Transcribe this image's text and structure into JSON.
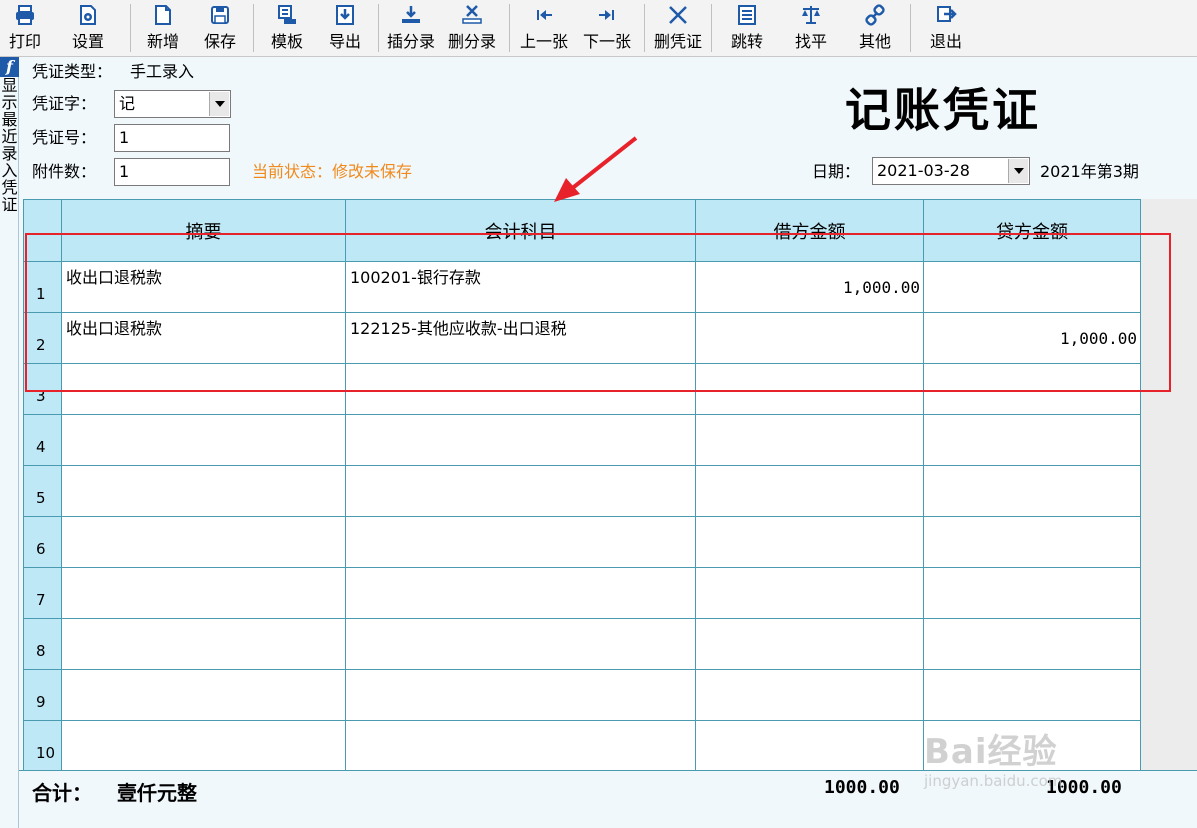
{
  "toolbar": {
    "items": [
      {
        "label": "打印",
        "icon": "printer-icon"
      },
      {
        "label": "设置",
        "icon": "settings-icon"
      },
      {
        "label": "新增",
        "icon": "new-document-icon"
      },
      {
        "label": "保存",
        "icon": "save-icon"
      },
      {
        "label": "模板",
        "icon": "template-icon"
      },
      {
        "label": "导出",
        "icon": "export-icon"
      },
      {
        "label": "插分录",
        "icon": "insert-entry-icon"
      },
      {
        "label": "删分录",
        "icon": "delete-entry-icon"
      },
      {
        "label": "上一张",
        "icon": "previous-icon"
      },
      {
        "label": "下一张",
        "icon": "next-icon"
      },
      {
        "label": "删凭证",
        "icon": "delete-voucher-icon"
      },
      {
        "label": "跳转",
        "icon": "jump-icon"
      },
      {
        "label": "找平",
        "icon": "balance-icon"
      },
      {
        "label": "其他",
        "icon": "link-icon"
      },
      {
        "label": "退出",
        "icon": "exit-icon"
      }
    ]
  },
  "sidebar": {
    "logo": "f",
    "vertical_label": "显示最近录入凭证"
  },
  "header": {
    "voucher_type_label": "凭证类型：",
    "voucher_type_value": "手工录入",
    "word_label": "凭证字：",
    "word_value": "记",
    "number_label": "凭证号：",
    "number_value": "1",
    "attachments_label": "附件数：",
    "attachments_value": "1",
    "status_text": "当前状态：修改未保存",
    "title": "记账凭证",
    "date_label": "日期：",
    "date_value": "2021-03-28",
    "period": "2021年第3期"
  },
  "grid": {
    "columns": [
      "摘要",
      "会计科目",
      "借方金额",
      "贷方金额"
    ],
    "rows": [
      {
        "num": "1",
        "summary": "收出口退税款",
        "account": "100201-银行存款",
        "debit": "1,000.00",
        "credit": ""
      },
      {
        "num": "2",
        "summary": "收出口退税款",
        "account": "122125-其他应收款-出口退税",
        "debit": "",
        "credit": "1,000.00"
      },
      {
        "num": "3",
        "summary": "",
        "account": "",
        "debit": "",
        "credit": ""
      },
      {
        "num": "4",
        "summary": "",
        "account": "",
        "debit": "",
        "credit": ""
      },
      {
        "num": "5",
        "summary": "",
        "account": "",
        "debit": "",
        "credit": ""
      },
      {
        "num": "6",
        "summary": "",
        "account": "",
        "debit": "",
        "credit": ""
      },
      {
        "num": "7",
        "summary": "",
        "account": "",
        "debit": "",
        "credit": ""
      },
      {
        "num": "8",
        "summary": "",
        "account": "",
        "debit": "",
        "credit": ""
      },
      {
        "num": "9",
        "summary": "",
        "account": "",
        "debit": "",
        "credit": ""
      },
      {
        "num": "10",
        "summary": "",
        "account": "",
        "debit": "",
        "credit": ""
      }
    ]
  },
  "total": {
    "label": "合计：",
    "amount_words": "壹仟元整",
    "debit_total": "1000.00",
    "credit_total": "1000.00"
  },
  "watermark": {
    "text": "Bai经验",
    "sub": "jingyan.baidu.com"
  },
  "colors": {
    "header_bg": "#bfe8f6",
    "grid_border": "#4a9ab0",
    "status": "#f08a1c",
    "annotation": "#e8222a",
    "icon_blue": "#1e5aa8"
  }
}
